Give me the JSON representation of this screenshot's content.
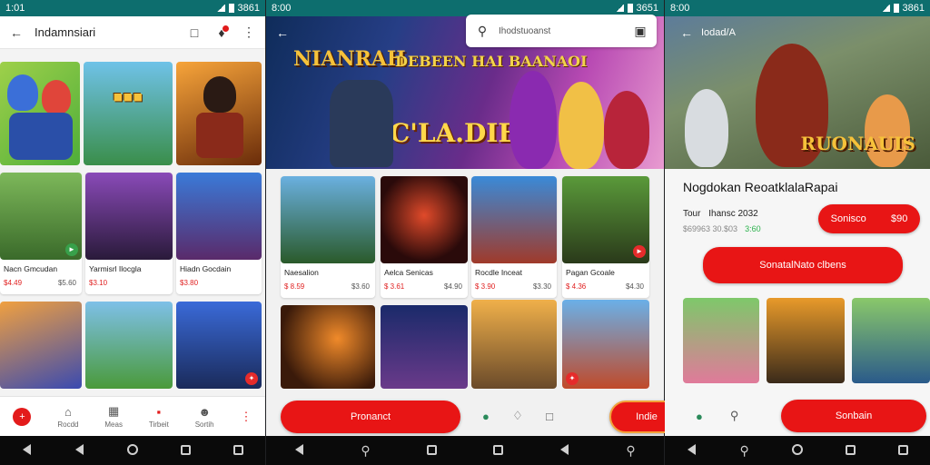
{
  "colors": {
    "accent": "#e81515",
    "status_bar": "#0d6e6e",
    "price": "#e02020",
    "rating_green": "#2bb24c"
  },
  "panel1": {
    "status": {
      "time": "1:01",
      "right": "3861"
    },
    "appbar": {
      "title": "Indamnsiari"
    },
    "cards": [
      {
        "name": "Nacn Gmcudan",
        "price": "$4.49",
        "rating": "$5.60"
      },
      {
        "name": "Yarmisrl Ilocgla",
        "price": "$3.10",
        "rating": ""
      },
      {
        "name": "Hiadn Gocdain",
        "price": "$3.80",
        "rating": ""
      }
    ],
    "tabs": [
      "Rocdd",
      "Meas",
      "Tirbeit",
      "Sortih"
    ]
  },
  "panel2": {
    "status": {
      "time": "8:00",
      "right": "3651"
    },
    "search": {
      "placeholder": "Ihodstuoanst"
    },
    "hero": {
      "logo": "NIANRAH",
      "tagline": "DEBEEN HAI BAANAOI",
      "big": "C'LA.DIE"
    },
    "cards": [
      {
        "name": "Naesalion",
        "price": "$ 8.59",
        "rating": "$3.60"
      },
      {
        "name": "Aelca Senicas",
        "price": "$ 3.61",
        "rating": "$4.90"
      },
      {
        "name": "Rocdle Inceat",
        "price": "$ 3.90",
        "rating": "$3.30"
      },
      {
        "name": "Pagan Gcoale",
        "price": "$ 4.36",
        "rating": "$4.30"
      }
    ],
    "buttons": {
      "primary": "Pronanct",
      "secondary": "Indie"
    }
  },
  "panel3": {
    "status": {
      "time": "8:00",
      "right": "3861"
    },
    "appbar": {
      "title": "Iodad/A"
    },
    "hero": {
      "logo": "RUONAUIS"
    },
    "detail": {
      "title": "Nogdokan Reoatkl​alaRapai",
      "meta_label": "Tour",
      "meta_value": "Ihansc 2032",
      "meta2": "$69963 30.$03",
      "rating": "3:60",
      "price_btn": "Sonisco",
      "price_btn_value": "$90",
      "cta": "SonatalNato clbens"
    },
    "bottom_btn": "Sonbain"
  }
}
